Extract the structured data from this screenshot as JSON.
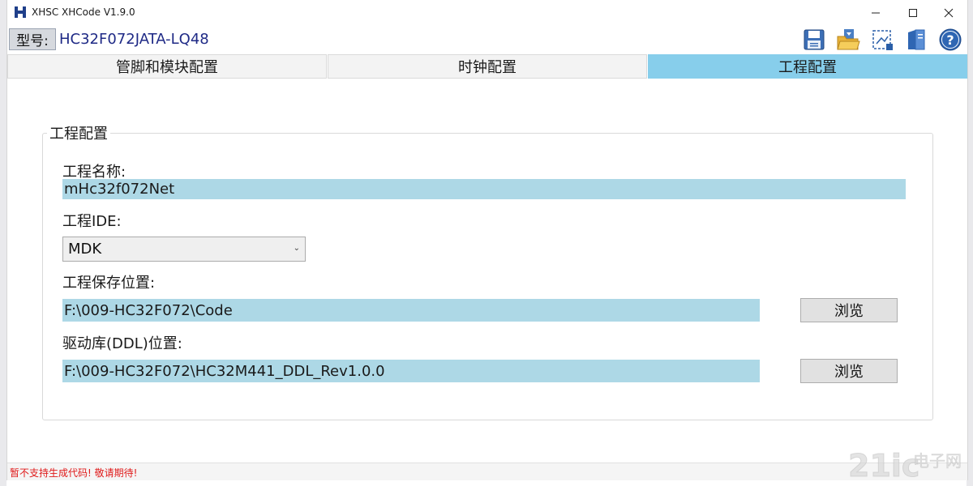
{
  "window": {
    "title": "XHSC XHCode V1.9.0",
    "controls": [
      "minimize",
      "maximize",
      "close"
    ]
  },
  "device": {
    "label": "型号:",
    "value": "HC32F072JATA-LQ48"
  },
  "toolbar": {
    "icons": [
      "save-icon",
      "open-folder-icon",
      "generate-code-icon",
      "document-icon",
      "help-icon"
    ]
  },
  "tabs": [
    {
      "label": "管脚和模块配置",
      "active": false
    },
    {
      "label": "时钟配置",
      "active": false
    },
    {
      "label": "工程配置",
      "active": true
    }
  ],
  "project": {
    "group_title": "工程配置",
    "name_label": "工程名称:",
    "name_value": "mHc32f072Net",
    "ide_label": "工程IDE:",
    "ide_value": "MDK",
    "save_label": "工程保存位置:",
    "save_value": "F:\\009-HC32F072\\Code",
    "ddl_label": "驱动库(DDL)位置:",
    "ddl_value": "F:\\009-HC32F072\\HC32M441_DDL_Rev1.0.0",
    "browse_label": "浏览"
  },
  "status": {
    "text": "暂不支持生成代码! 敬请期待!"
  },
  "watermark": {
    "logo": "21ic",
    "text": "电子网"
  },
  "colors": {
    "active_tab": "#87ceeb",
    "field_bg": "#add8e6",
    "model_value": "#1f2a86",
    "status_text": "#e01a1a"
  }
}
